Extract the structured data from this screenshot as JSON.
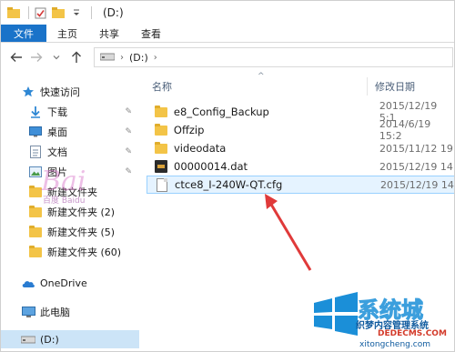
{
  "window": {
    "title": "(D:)"
  },
  "ribbon": {
    "tabs": [
      "文件",
      "主页",
      "共享",
      "查看"
    ]
  },
  "address": {
    "location": "(D:)"
  },
  "navpane": {
    "quick_access": "快速访问",
    "pinned": [
      "下载",
      "桌面",
      "文档",
      "图片"
    ],
    "folders": [
      "新建文件夹",
      "新建文件夹 (2)",
      "新建文件夹 (5)",
      "新建文件夹 (60)"
    ],
    "onedrive": "OneDrive",
    "this_pc": "此电脑",
    "drive": "(D:)"
  },
  "columns": {
    "name": "名称",
    "date": "修改日期"
  },
  "files": [
    {
      "name": "e8_Config_Backup",
      "date": "2015/12/19 5:1",
      "type": "folder"
    },
    {
      "name": "Offzip",
      "date": "2014/6/19 15:2",
      "type": "folder"
    },
    {
      "name": "videodata",
      "date": "2015/11/12 19",
      "type": "folder"
    },
    {
      "name": "00000014.dat",
      "date": "2015/12/19 14",
      "type": "dat"
    },
    {
      "name": "ctce8_I-240W-QT.cfg",
      "date": "2015/12/19 14",
      "type": "cfg"
    }
  ],
  "watermarks": {
    "bottom_right_1": "系统城",
    "bottom_right_2": "织梦内容管理系统",
    "bottom_right_3": "DEDECMS.COM",
    "bottom_right_4": "xitongcheng.com",
    "logo_text": "百度 Baidu"
  },
  "colors": {
    "accent": "#1a73c9",
    "selection": "#e5f3ff",
    "arrow": "#e03a3a"
  }
}
